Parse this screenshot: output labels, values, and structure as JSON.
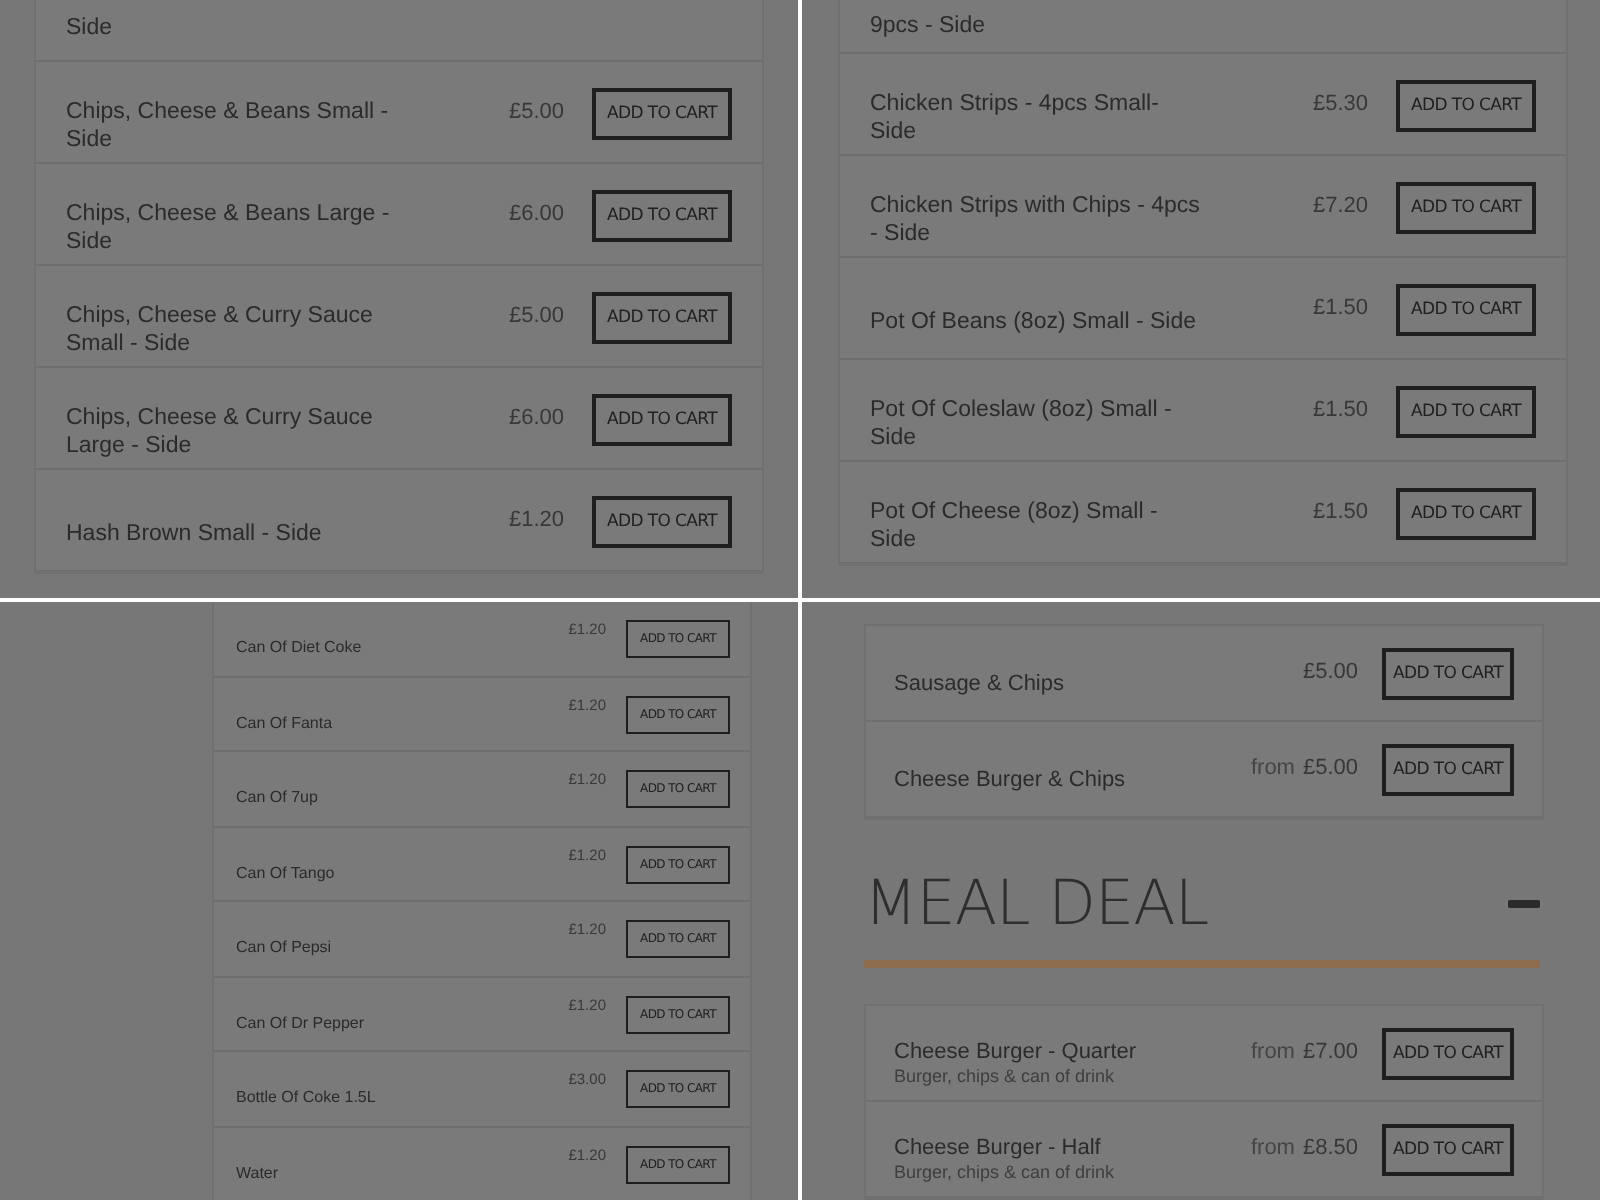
{
  "panels": [
    {
      "blocks": [
        {
          "kind": "list",
          "items": [
            {
              "kind": "partial",
              "name": "Side"
            },
            {
              "kind": "item",
              "name": "Chips, Cheese & Beans Small - Side",
              "price": "£5.00",
              "button": "ADD TO CART"
            },
            {
              "kind": "item",
              "name": "Chips, Cheese & Beans Large - Side",
              "price": "£6.00",
              "button": "ADD TO CART"
            },
            {
              "kind": "item",
              "name": "Chips, Cheese & Curry Sauce Small - Side",
              "price": "£5.00",
              "button": "ADD TO CART"
            },
            {
              "kind": "item",
              "name": "Chips, Cheese & Curry Sauce Large - Side",
              "price": "£6.00",
              "button": "ADD TO CART"
            },
            {
              "kind": "item",
              "name": "Hash Brown Small - Side",
              "price": "£1.20",
              "button": "ADD TO CART"
            }
          ]
        }
      ]
    },
    {
      "blocks": [
        {
          "kind": "list",
          "items": [
            {
              "kind": "partial",
              "name": "9pcs - Side"
            },
            {
              "kind": "item",
              "name": "Chicken Strips - 4pcs Small- Side",
              "price": "£5.30",
              "button": "ADD TO CART"
            },
            {
              "kind": "item",
              "name": "Chicken Strips with Chips - 4pcs - Side",
              "price": "£7.20",
              "button": "ADD TO CART"
            },
            {
              "kind": "item",
              "name": "Pot Of Beans (8oz) Small - Side",
              "price": "£1.50",
              "button": "ADD TO CART"
            },
            {
              "kind": "item",
              "name": "Pot Of Coleslaw (8oz) Small - Side",
              "price": "£1.50",
              "button": "ADD TO CART"
            },
            {
              "kind": "item",
              "name": "Pot Of Cheese (8oz) Small - Side",
              "price": "£1.50",
              "button": "ADD TO CART"
            }
          ]
        }
      ]
    },
    {
      "blocks": [
        {
          "kind": "list",
          "items": [
            {
              "kind": "item",
              "name": "Can Of Diet Coke",
              "price": "£1.20",
              "button": "ADD TO CART"
            },
            {
              "kind": "item",
              "name": "Can Of Fanta",
              "price": "£1.20",
              "button": "ADD TO CART"
            },
            {
              "kind": "item",
              "name": "Can Of 7up",
              "price": "£1.20",
              "button": "ADD TO CART"
            },
            {
              "kind": "item",
              "name": "Can Of Tango",
              "price": "£1.20",
              "button": "ADD TO CART"
            },
            {
              "kind": "item",
              "name": "Can Of Pepsi",
              "price": "£1.20",
              "button": "ADD TO CART"
            },
            {
              "kind": "item",
              "name": "Can Of Dr Pepper",
              "price": "£1.20",
              "button": "ADD TO CART"
            },
            {
              "kind": "item",
              "name": "Bottle Of Coke 1.5L",
              "price": "£3.00",
              "button": "ADD TO CART"
            },
            {
              "kind": "item",
              "name": "Water",
              "price": "£1.20",
              "button": "ADD TO CART"
            }
          ]
        }
      ]
    },
    {
      "blocks": [
        {
          "kind": "list",
          "items": [
            {
              "kind": "item",
              "name": "Sausage & Chips",
              "price": "£5.00",
              "button": "ADD TO CART"
            },
            {
              "kind": "item",
              "name": "Cheese Burger & Chips",
              "prefix": "from",
              "price": "£5.00",
              "button": "ADD TO CART"
            }
          ]
        },
        {
          "kind": "heading",
          "title": "MEAL DEAL",
          "expanded": true
        },
        {
          "kind": "list",
          "items": [
            {
              "kind": "item",
              "name": "Cheese Burger - Quarter",
              "description": "Burger, chips & can of drink",
              "prefix": "from",
              "price": "£7.00",
              "button": "ADD TO CART"
            },
            {
              "kind": "item",
              "name": "Cheese Burger - Half",
              "description": "Burger, chips & can of drink",
              "prefix": "from",
              "price": "£8.50",
              "button": "ADD TO CART"
            }
          ]
        }
      ]
    }
  ]
}
